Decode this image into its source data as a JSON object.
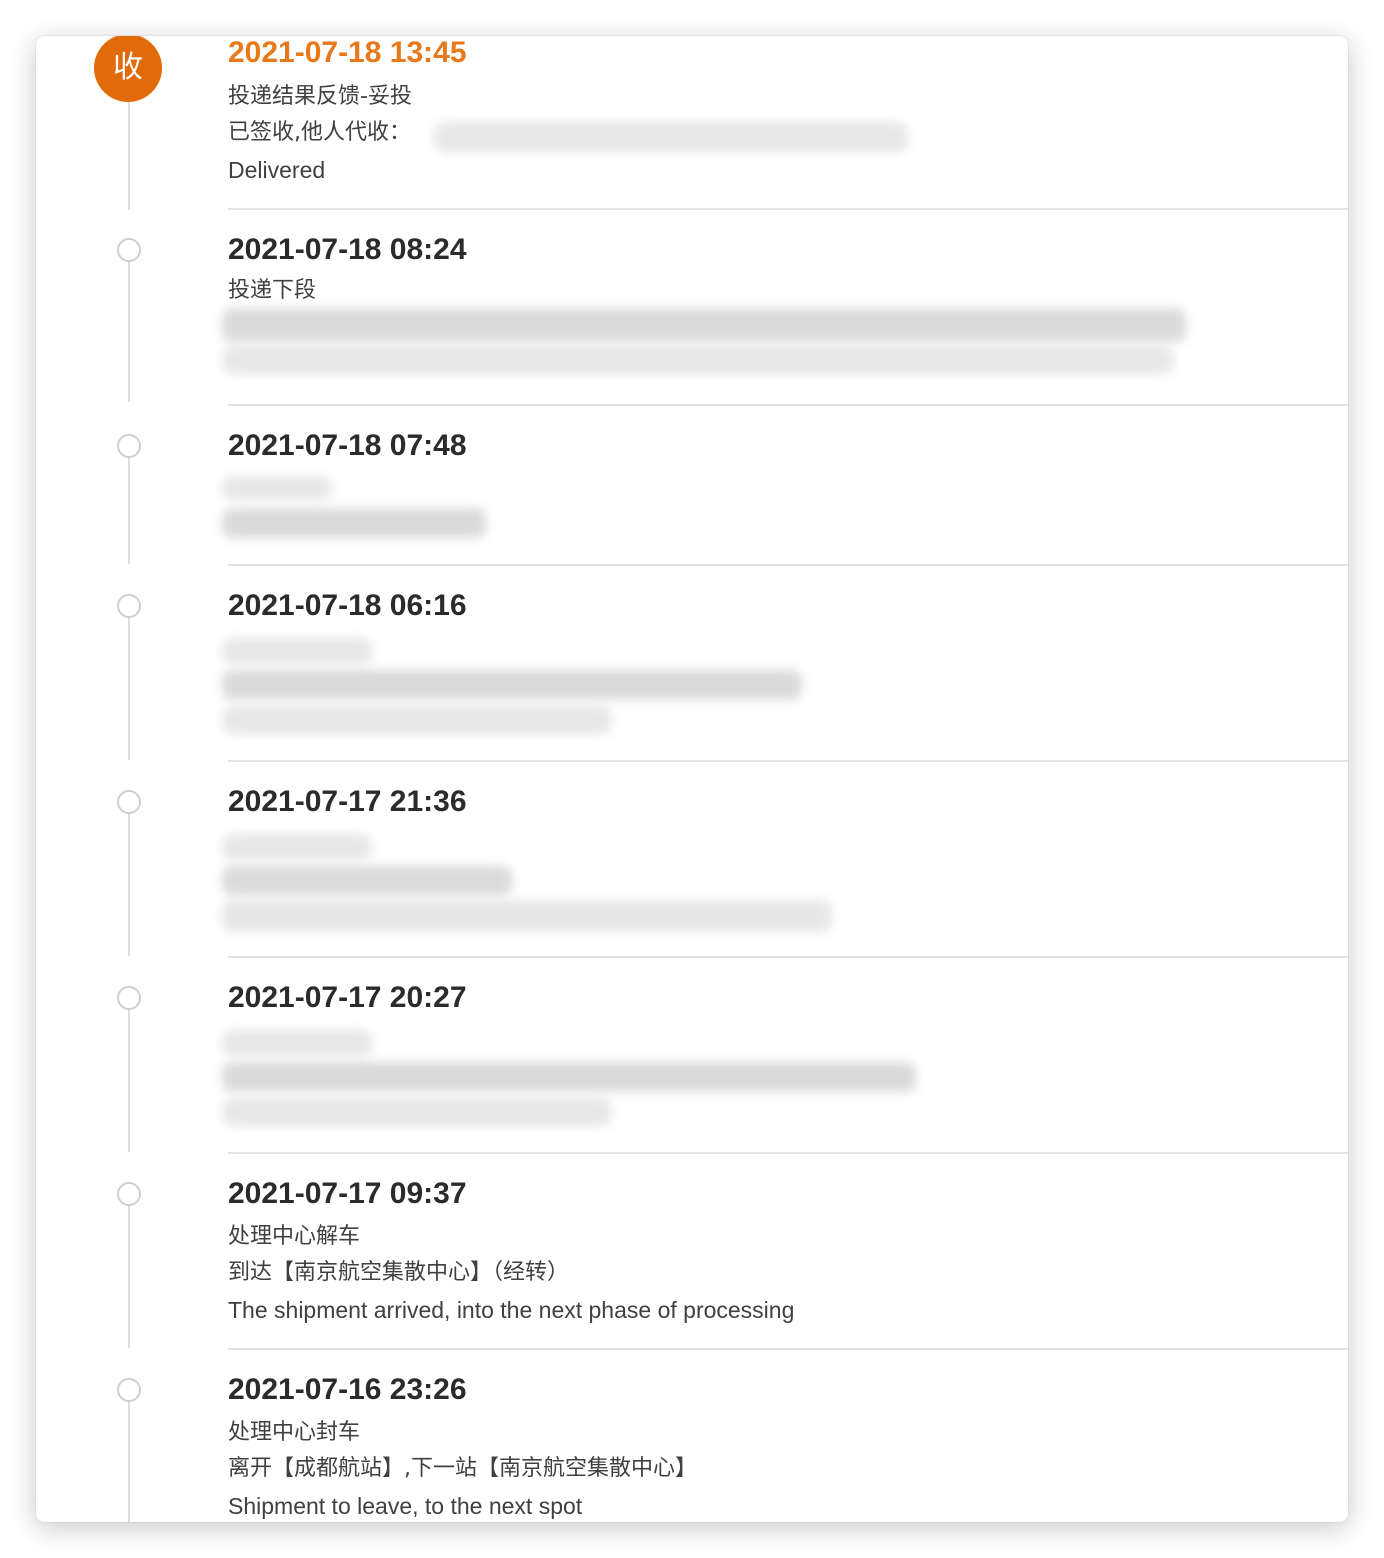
{
  "colors": {
    "accent": "#e8791a",
    "active_node": "#e26a08",
    "text": "#404040",
    "time_text": "#2b2b2b",
    "rail": "#dddddd",
    "divider": "#e2e2e2"
  },
  "timeline": [
    {
      "time": "2021-07-18 13:45",
      "status": "active",
      "badge": "收",
      "lines": [
        "投递结果反馈-妥投",
        "已签收,他人代收：",
        "Delivered"
      ]
    },
    {
      "time": "2021-07-18 08:24",
      "status": "done",
      "lines": [
        "投递下段"
      ]
    },
    {
      "time": "2021-07-18 07:48",
      "status": "done",
      "lines": []
    },
    {
      "time": "2021-07-18 06:16",
      "status": "done",
      "lines": []
    },
    {
      "time": "2021-07-17 21:36",
      "status": "done",
      "lines": []
    },
    {
      "time": "2021-07-17 20:27",
      "status": "done",
      "lines": []
    },
    {
      "time": "2021-07-17 09:37",
      "status": "done",
      "lines": [
        "处理中心解车",
        "到达【南京航空集散中心】（经转）",
        "The shipment arrived, into the next phase of processing"
      ]
    },
    {
      "time": "2021-07-16 23:26",
      "status": "done",
      "lines": [
        "处理中心封车",
        "离开【成都航站】,下一站【南京航空集散中心】",
        "Shipment to leave, to the next spot"
      ]
    }
  ]
}
